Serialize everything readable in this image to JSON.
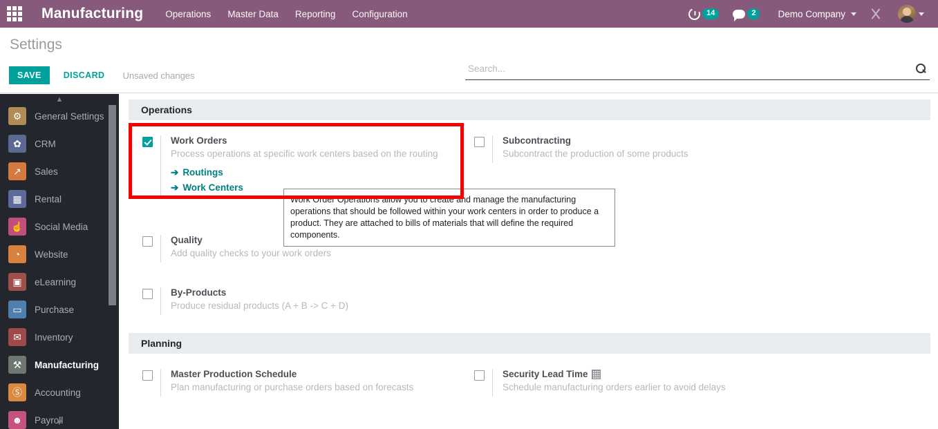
{
  "topbar": {
    "apps_icon": "apps-grid-icon",
    "brand": "Manufacturing",
    "menu": [
      {
        "label": "Operations"
      },
      {
        "label": "Master Data"
      },
      {
        "label": "Reporting"
      },
      {
        "label": "Configuration"
      }
    ],
    "activities": {
      "icon": "clock-icon",
      "count": "14"
    },
    "messages": {
      "icon": "chat-icon",
      "count": "2"
    },
    "company": "Demo Company",
    "tools_icon": "tools-icon",
    "avatar": "user-avatar"
  },
  "control_panel": {
    "title": "Settings",
    "save_label": "SAVE",
    "discard_label": "DISCARD",
    "status": "Unsaved changes",
    "search": {
      "value": "",
      "placeholder": "Search..."
    }
  },
  "sidebar": {
    "items": [
      {
        "label": "General Settings",
        "icon": "gear-icon",
        "glyph": "⚙",
        "color": "#b08b55",
        "active": false
      },
      {
        "label": "CRM",
        "icon": "handshake-icon",
        "glyph": "✿",
        "color": "#5c6a92",
        "active": false
      },
      {
        "label": "Sales",
        "icon": "chart-up-icon",
        "glyph": "↗",
        "color": "#d4793f",
        "active": false
      },
      {
        "label": "Rental",
        "icon": "calendar-icon",
        "glyph": "▦",
        "color": "#5d6a9c",
        "active": false
      },
      {
        "label": "Social Media",
        "icon": "thumbs-up-icon",
        "glyph": "☝",
        "color": "#c24f7b",
        "active": false
      },
      {
        "label": "Website",
        "icon": "globe-icon",
        "glyph": "◔",
        "color": "#d9823f",
        "active": false
      },
      {
        "label": "eLearning",
        "icon": "presentation-icon",
        "glyph": "▣",
        "color": "#9e4f4a",
        "active": false
      },
      {
        "label": "Purchase",
        "icon": "card-icon",
        "glyph": "▭",
        "color": "#4e7fae",
        "active": false
      },
      {
        "label": "Inventory",
        "icon": "box-icon",
        "glyph": "✉",
        "color": "#9e4a4a",
        "active": false
      },
      {
        "label": "Manufacturing",
        "icon": "wrench-icon",
        "glyph": "⚒",
        "color": "#6e7872",
        "active": true
      },
      {
        "label": "Accounting",
        "icon": "invoice-icon",
        "glyph": "Ⓢ",
        "color": "#d98a3f",
        "active": false
      },
      {
        "label": "Payroll",
        "icon": "people-icon",
        "glyph": "☻",
        "color": "#c4547d",
        "active": false
      }
    ],
    "scroll_up": "▲",
    "scroll_down": "▼"
  },
  "sections": [
    {
      "name": "operations-section",
      "title": "Operations",
      "settings": [
        {
          "key": "work-orders",
          "title": "Work Orders",
          "description": "Process operations at specific work centers based on the routing",
          "checked": true,
          "company_dependent": false,
          "links": [
            {
              "label": "Routings",
              "arrow": "➔"
            },
            {
              "label": "Work Centers",
              "arrow": "➔"
            }
          ]
        },
        {
          "key": "subcontracting",
          "title": "Subcontracting",
          "description": "Subcontract the production of some products",
          "checked": false,
          "company_dependent": false,
          "links": []
        },
        {
          "key": "quality",
          "title": "Quality",
          "description": "Add quality checks to your work orders",
          "checked": false,
          "company_dependent": false,
          "links": []
        },
        {
          "key": "by-products",
          "title": "By-Products",
          "description": "Produce residual products (A + B -> C + D)",
          "checked": false,
          "company_dependent": false,
          "links": []
        }
      ]
    },
    {
      "name": "planning-section",
      "title": "Planning",
      "settings": [
        {
          "key": "master-production-schedule",
          "title": "Master Production Schedule",
          "description": "Plan manufacturing or purchase orders based on forecasts",
          "checked": false,
          "company_dependent": false,
          "links": []
        },
        {
          "key": "security-lead-time",
          "title": "Security Lead Time",
          "description": "Schedule manufacturing orders earlier to avoid delays",
          "checked": false,
          "company_dependent": true,
          "links": []
        }
      ]
    }
  ],
  "tooltip": {
    "text": "Work Order Operations allow you to create and manage the manufacturing operations that should be followed within your work centers in order to produce a product. They are attached to bills of materials that will define the required components."
  },
  "annotation": {
    "shape": "rectangle",
    "color": "#f40000",
    "targets": "work-orders-setting"
  },
  "colors": {
    "brand_purple": "#875A7B",
    "accent_teal": "#00A09D",
    "link_teal": "#017e84",
    "sidebar_dark": "#23262c",
    "section_header_bg": "#e9ecef",
    "annotation_red": "#f40000"
  }
}
